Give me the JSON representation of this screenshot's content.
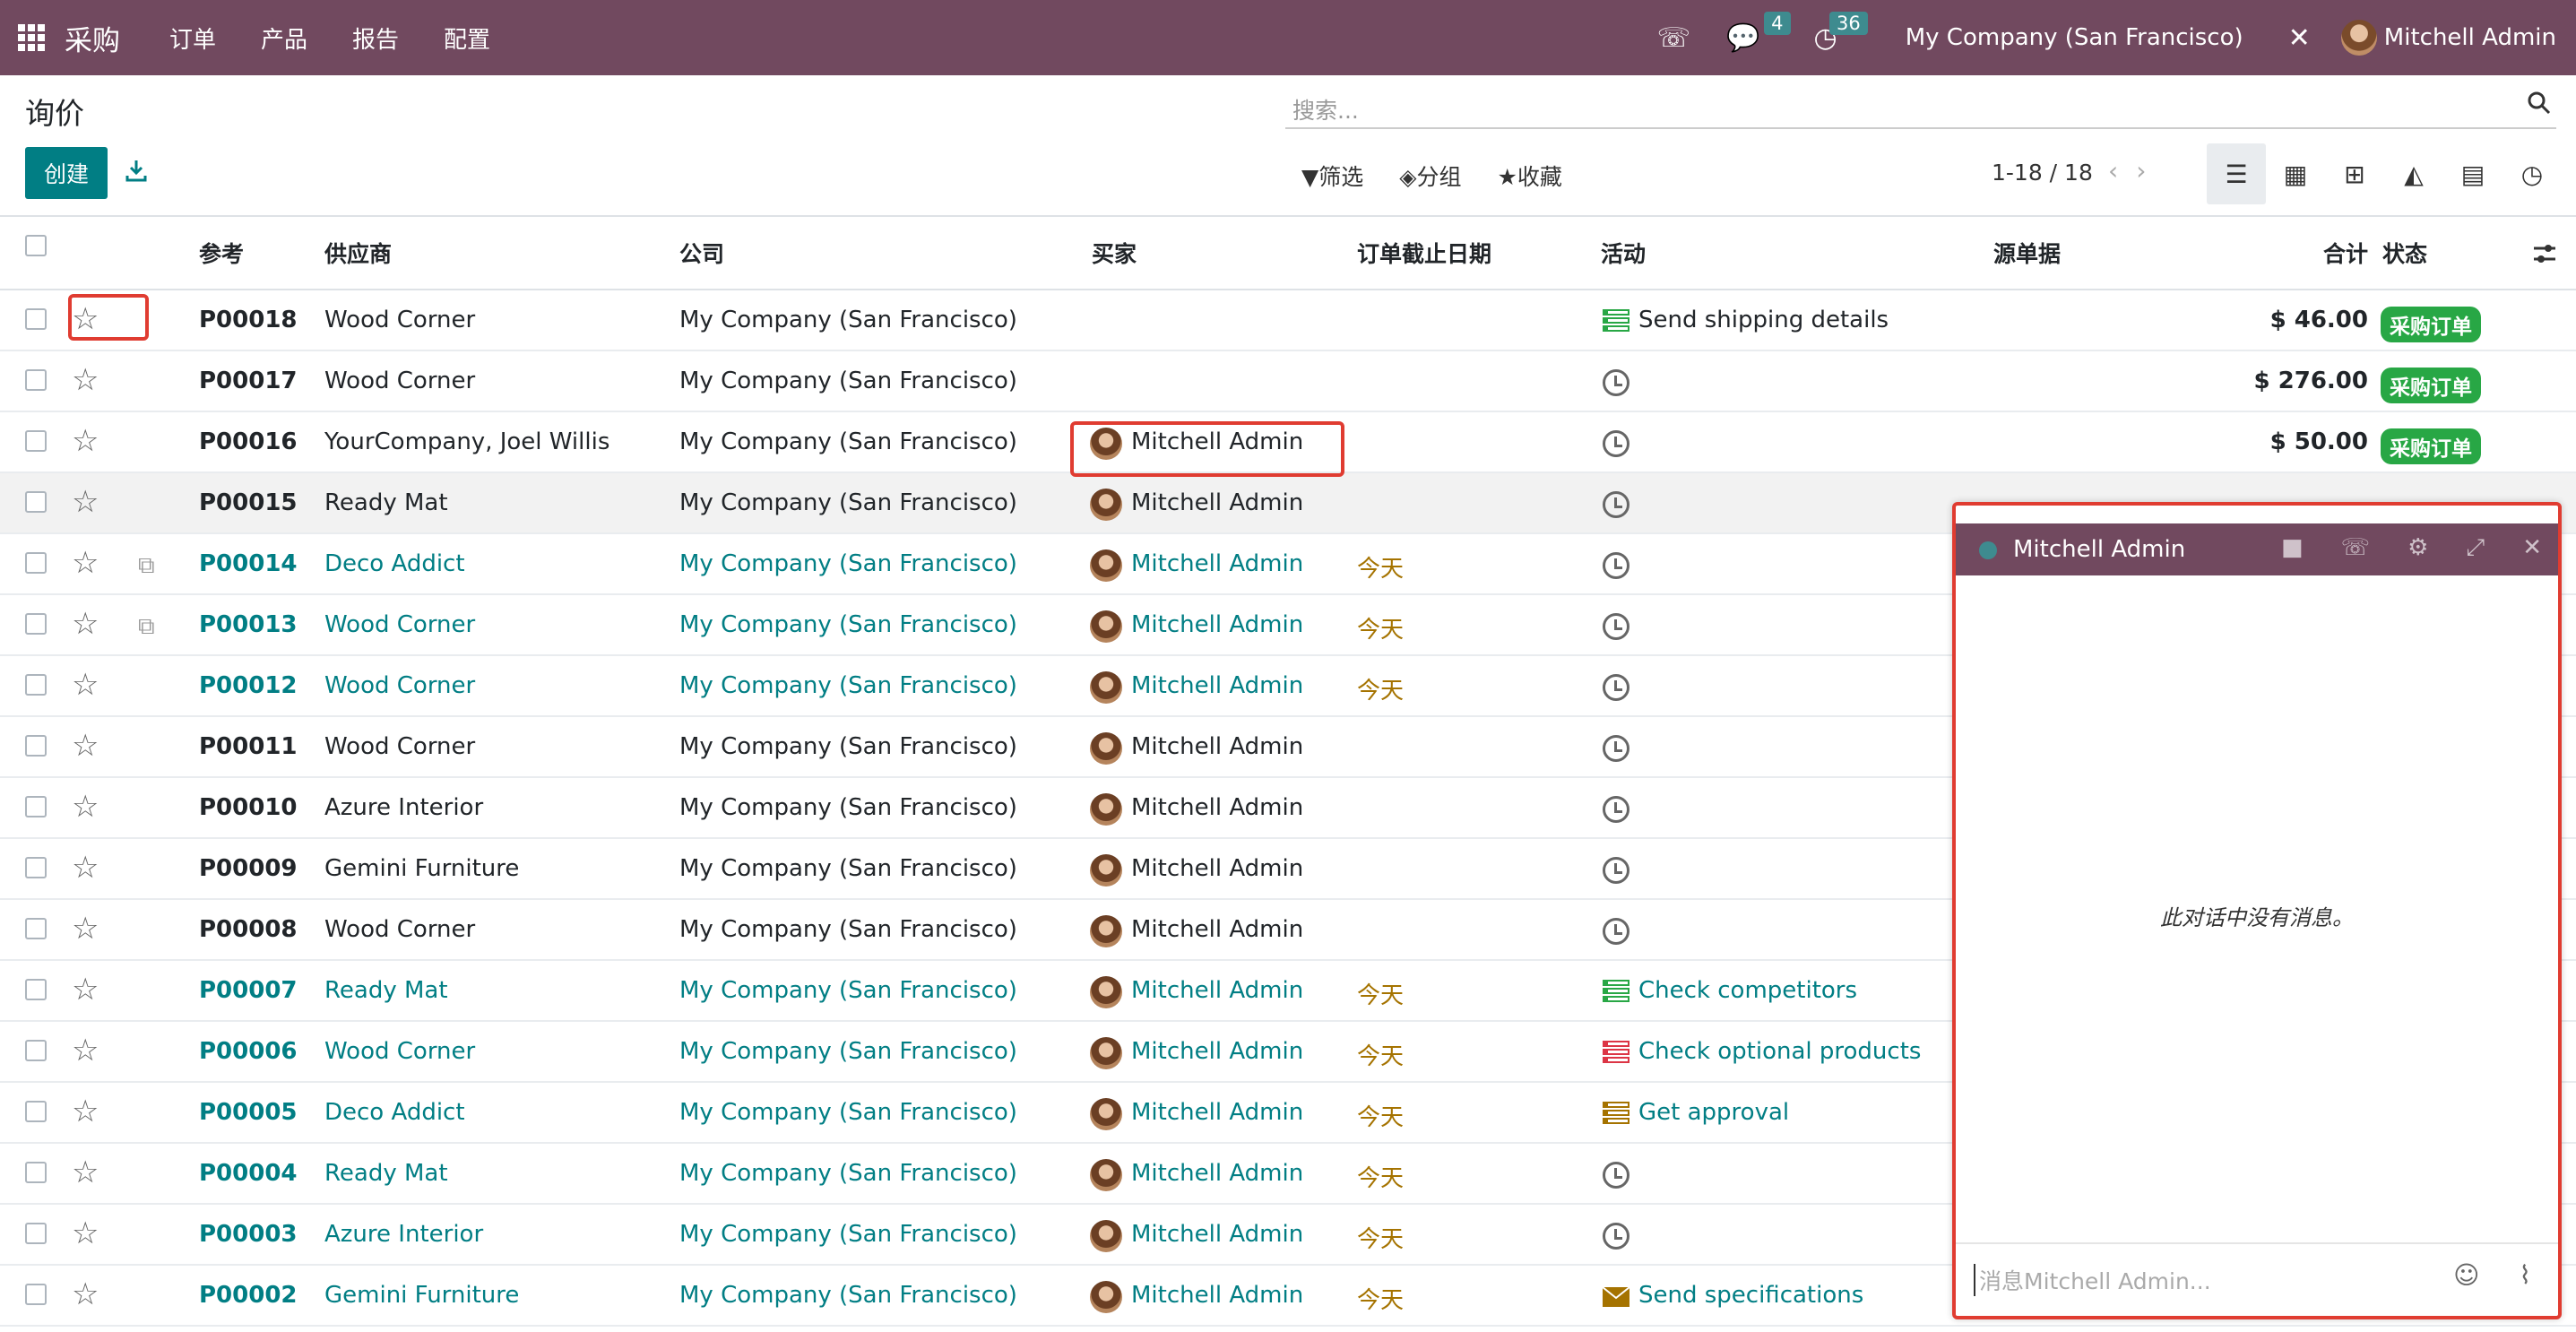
{
  "app": {
    "title": "采购",
    "menus": [
      "订单",
      "产品",
      "报告",
      "配置"
    ],
    "badges": {
      "messages": "4",
      "activities": "36"
    },
    "company": "My Company (San Francisco)",
    "user": "Mitchell Admin"
  },
  "page": {
    "title": "询价",
    "create_label": "创建",
    "search_placeholder": "搜索...",
    "filters": [
      "筛选",
      "分组",
      "收藏"
    ],
    "pager": "1-18 / 18"
  },
  "table": {
    "headers": [
      "参考",
      "供应商",
      "公司",
      "买家",
      "订单截止日期",
      "活动",
      "源单据",
      "合计",
      "状态"
    ],
    "rows": [
      {
        "ref": "P00018",
        "vendor": "Wood Corner",
        "company": "My Company (San Francisco)",
        "buyer": "",
        "deadline": "",
        "activity": "Send shipping details",
        "activity_color": "#28a745",
        "total": "$ 46.00",
        "status": "采购订单",
        "link": false
      },
      {
        "ref": "P00017",
        "vendor": "Wood Corner",
        "company": "My Company (San Francisco)",
        "buyer": "",
        "deadline": "",
        "activity": "",
        "total": "$ 276.00",
        "status": "采购订单",
        "link": false
      },
      {
        "ref": "P00016",
        "vendor": "YourCompany, Joel Willis",
        "company": "My Company (San Francisco)",
        "buyer": "Mitchell Admin",
        "deadline": "",
        "activity": "",
        "total": "$ 50.00",
        "status": "采购订单",
        "link": false
      },
      {
        "ref": "P00015",
        "vendor": "Ready Mat",
        "company": "My Company (San Francisco)",
        "buyer": "Mitchell Admin",
        "deadline": "",
        "activity": "",
        "total": "",
        "status": "",
        "link": false
      },
      {
        "ref": "P00014",
        "vendor": "Deco Addict",
        "company": "My Company (San Francisco)",
        "buyer": "Mitchell Admin",
        "deadline": "今天",
        "activity": "",
        "total": "",
        "status": "",
        "link": true
      },
      {
        "ref": "P00013",
        "vendor": "Wood Corner",
        "company": "My Company (San Francisco)",
        "buyer": "Mitchell Admin",
        "deadline": "今天",
        "activity": "",
        "total": "",
        "status": "",
        "link": true
      },
      {
        "ref": "P00012",
        "vendor": "Wood Corner",
        "company": "My Company (San Francisco)",
        "buyer": "Mitchell Admin",
        "deadline": "今天",
        "activity": "",
        "total": "",
        "status": "",
        "link": true
      },
      {
        "ref": "P00011",
        "vendor": "Wood Corner",
        "company": "My Company (San Francisco)",
        "buyer": "Mitchell Admin",
        "deadline": "",
        "activity": "",
        "total": "",
        "status": "",
        "link": false
      },
      {
        "ref": "P00010",
        "vendor": "Azure Interior",
        "company": "My Company (San Francisco)",
        "buyer": "Mitchell Admin",
        "deadline": "",
        "activity": "",
        "total": "",
        "status": "",
        "link": false
      },
      {
        "ref": "P00009",
        "vendor": "Gemini Furniture",
        "company": "My Company (San Francisco)",
        "buyer": "Mitchell Admin",
        "deadline": "",
        "activity": "",
        "total": "",
        "status": "",
        "link": false
      },
      {
        "ref": "P00008",
        "vendor": "Wood Corner",
        "company": "My Company (San Francisco)",
        "buyer": "Mitchell Admin",
        "deadline": "",
        "activity": "",
        "total": "",
        "status": "",
        "link": false
      },
      {
        "ref": "P00007",
        "vendor": "Ready Mat",
        "company": "My Company (San Francisco)",
        "buyer": "Mitchell Admin",
        "deadline": "今天",
        "activity": "Check competitors",
        "activity_color": "#28a745",
        "total": "",
        "status": "",
        "link": true
      },
      {
        "ref": "P00006",
        "vendor": "Wood Corner",
        "company": "My Company (San Francisco)",
        "buyer": "Mitchell Admin",
        "deadline": "今天",
        "activity": "Check optional products",
        "activity_color": "#dc3545",
        "total": "",
        "status": "",
        "link": true
      },
      {
        "ref": "P00005",
        "vendor": "Deco Addict",
        "company": "My Company (San Francisco)",
        "buyer": "Mitchell Admin",
        "deadline": "今天",
        "activity": "Get approval",
        "activity_color": "#a57300",
        "total": "",
        "status": "",
        "link": true
      },
      {
        "ref": "P00004",
        "vendor": "Ready Mat",
        "company": "My Company (San Francisco)",
        "buyer": "Mitchell Admin",
        "deadline": "今天",
        "activity": "",
        "total": "",
        "status": "",
        "link": true
      },
      {
        "ref": "P00003",
        "vendor": "Azure Interior",
        "company": "My Company (San Francisco)",
        "buyer": "Mitchell Admin",
        "deadline": "今天",
        "activity": "",
        "total": "",
        "status": "",
        "link": true
      },
      {
        "ref": "P00002",
        "vendor": "Gemini Furniture",
        "company": "My Company (San Francisco)",
        "buyer": "Mitchell Admin",
        "deadline": "今天",
        "activity": "Send specifications",
        "activity_color": "#a57300",
        "total": "",
        "status": "",
        "link": true
      }
    ]
  },
  "chat": {
    "title": "Mitchell Admin",
    "empty": "此对话中没有消息。",
    "placeholder": "消息Mitchell Admin..."
  },
  "colors": {
    "brand": "#71495f",
    "primary": "#017e84",
    "success": "#28a745",
    "highlight": "#e03c31"
  }
}
